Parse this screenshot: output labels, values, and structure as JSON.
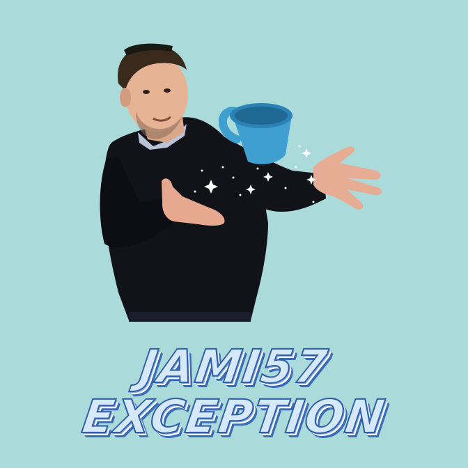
{
  "background_color": "#abdadb",
  "colors": {
    "sweater": "#111319",
    "skin": "#e6b394",
    "hair": "#3a2a1c",
    "mug": "#3f9fd0",
    "title_fill": "#d6e8fb",
    "title_outline": "#2f5fa8"
  },
  "icons": {
    "mug": "coffee-mug-icon",
    "sparkle": "sparkle-icon"
  },
  "title": {
    "line1": "JAMI57",
    "line2": "EXCEPTION"
  }
}
